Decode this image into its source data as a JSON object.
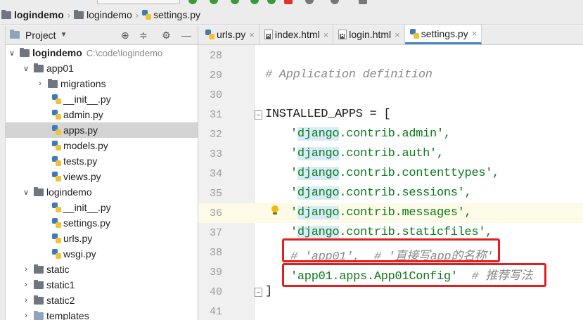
{
  "breadcrumb": {
    "items": [
      "logindemo",
      "logindemo",
      "settings.py"
    ]
  },
  "project_panel": {
    "title": "Project",
    "tree": [
      {
        "label": "logindemo",
        "path": "C:\\code\\logindemo",
        "icon": "folder-icon"
      },
      {
        "label": "app01",
        "icon": "folder-icon"
      },
      {
        "label": "migrations",
        "icon": "folder-icon"
      },
      {
        "label": "__init__.py",
        "icon": "python-file-icon"
      },
      {
        "label": "admin.py",
        "icon": "python-file-icon"
      },
      {
        "label": "apps.py",
        "icon": "python-file-icon"
      },
      {
        "label": "models.py",
        "icon": "python-file-icon"
      },
      {
        "label": "tests.py",
        "icon": "python-file-icon"
      },
      {
        "label": "views.py",
        "icon": "python-file-icon"
      },
      {
        "label": "logindemo",
        "icon": "folder-icon"
      },
      {
        "label": "__init__.py",
        "icon": "python-file-icon"
      },
      {
        "label": "settings.py",
        "icon": "python-file-icon"
      },
      {
        "label": "urls.py",
        "icon": "python-file-icon"
      },
      {
        "label": "wsgi.py",
        "icon": "python-file-icon"
      },
      {
        "label": "static",
        "icon": "folder-icon"
      },
      {
        "label": "static1",
        "icon": "folder-icon"
      },
      {
        "label": "static2",
        "icon": "folder-icon"
      },
      {
        "label": "templates",
        "icon": "folder-icon"
      }
    ]
  },
  "editor": {
    "tabs": [
      {
        "label": "urls.py",
        "icon": "python-file-icon"
      },
      {
        "label": "index.html",
        "icon": "html-file-icon"
      },
      {
        "label": "login.html",
        "icon": "html-file-icon"
      },
      {
        "label": "settings.py",
        "icon": "python-file-icon",
        "active": true
      }
    ],
    "line_numbers": [
      "28",
      "29",
      "30",
      "31",
      "32",
      "33",
      "34",
      "35",
      "36",
      "37",
      "38",
      "39",
      "40",
      "41"
    ],
    "code": {
      "l29": "# Application definition",
      "l31": "INSTALLED_APPS = [",
      "l32_hl": "django",
      "l32_rest": ".contrib.admin',",
      "l33_rest": ".contrib.auth',",
      "l34_rest": ".contrib.contenttypes',",
      "l35_rest": ".contrib.sessions',",
      "l36_rest": ".contrib.messages',",
      "l37_rest": ".contrib.staticfiles',",
      "quote": "'",
      "l38": "# 'app01',  # '直接写app的名称'",
      "l39_str": "'app01.apps.App01Config'",
      "l39_cmt": "# 推荐写法",
      "l40": "]"
    },
    "highlight_color": "#e41e1e"
  }
}
